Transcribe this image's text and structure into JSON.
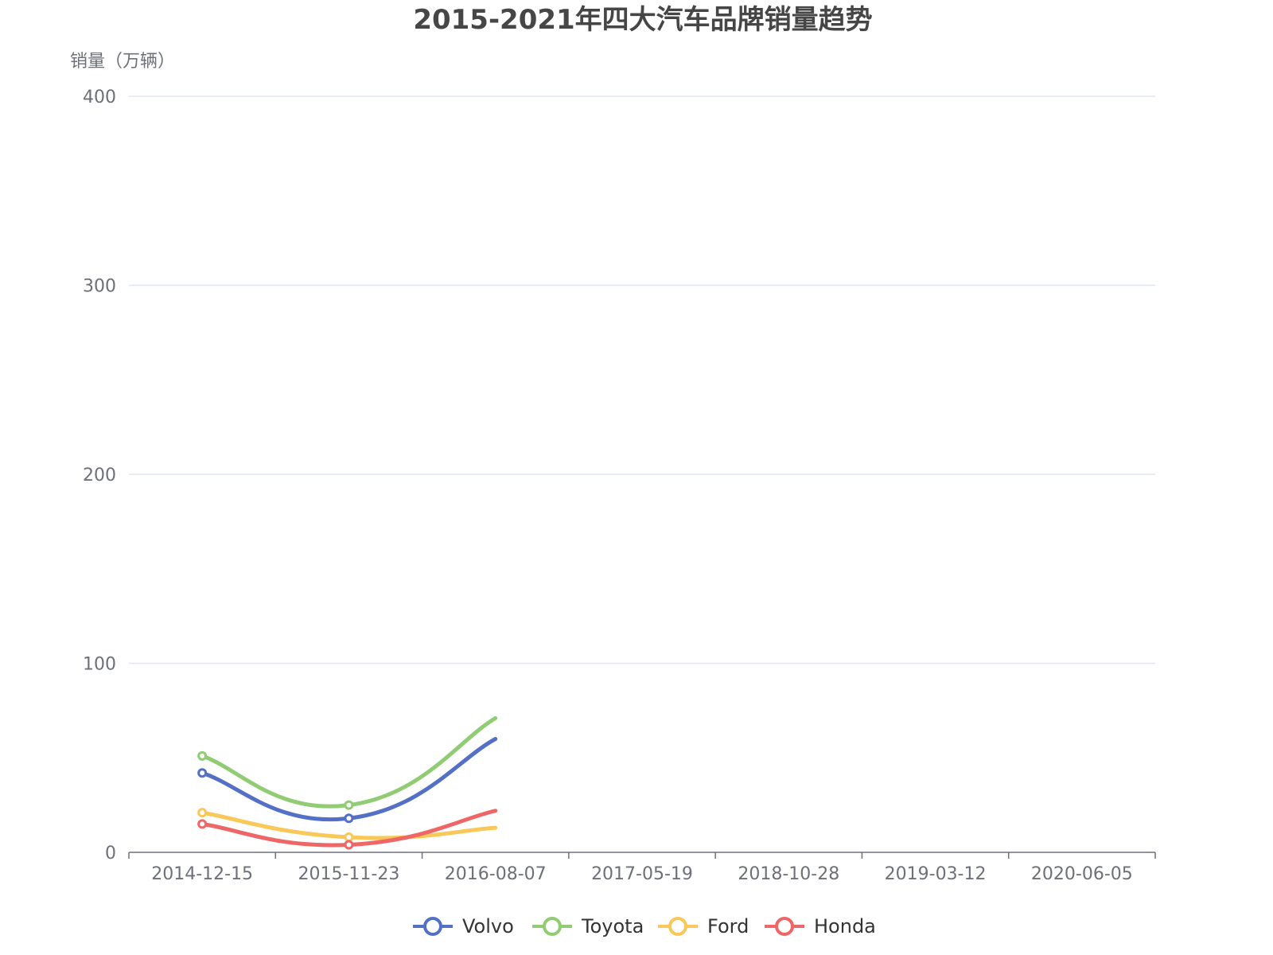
{
  "chart_data": {
    "type": "line",
    "title": "2015-2021年四大汽车品牌销量趋势",
    "ylabel": "销量（万辆）",
    "xlabel": "",
    "ylim": [
      0,
      400
    ],
    "yticks": [
      0,
      100,
      200,
      300,
      400
    ],
    "grid": true,
    "smooth": true,
    "legend_position": "bottom-center",
    "categories": [
      "2014-12-15",
      "2015-11-23",
      "2016-08-07",
      "2017-05-19",
      "2018-10-28",
      "2019-03-12",
      "2020-06-05"
    ],
    "series": [
      {
        "name": "Volvo",
        "color": "#5470c6",
        "values": [
          42,
          18,
          60
        ]
      },
      {
        "name": "Toyota",
        "color": "#91cc75",
        "values": [
          51,
          25,
          71
        ]
      },
      {
        "name": "Ford",
        "color": "#fac858",
        "values": [
          21,
          8,
          13
        ]
      },
      {
        "name": "Honda",
        "color": "#ee6666",
        "values": [
          15,
          4,
          22
        ]
      }
    ]
  }
}
